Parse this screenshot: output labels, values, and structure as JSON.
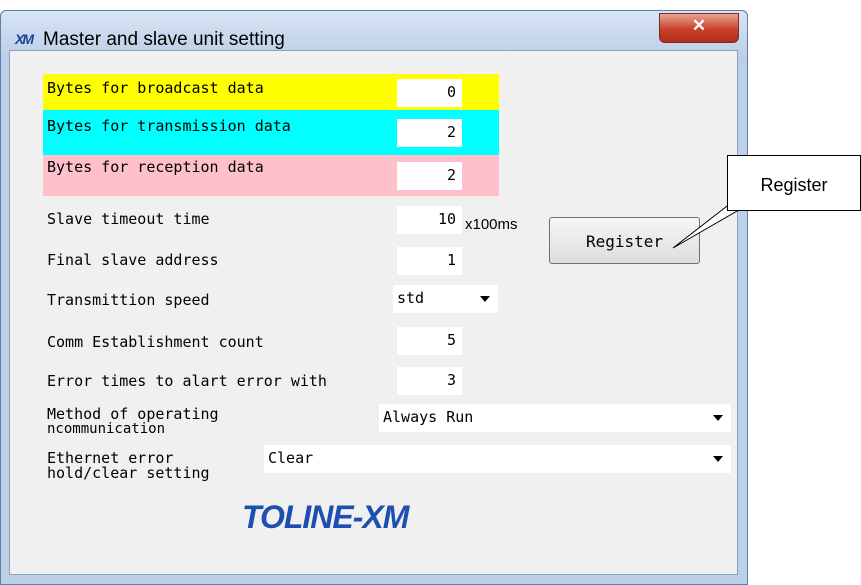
{
  "window": {
    "title": "Master and slave unit setting",
    "icon": "XM"
  },
  "colors": {
    "broadcast_band": "#ffff00",
    "transmission_band": "#00ffff",
    "reception_band": "#ffc0cb",
    "logo": "#1c4fb0"
  },
  "fields": {
    "broadcast": {
      "label": "Bytes for broadcast data",
      "value": "0"
    },
    "transmission": {
      "label": "Bytes for transmission data",
      "value": "2"
    },
    "reception": {
      "label": "Bytes for reception data",
      "value": "2"
    },
    "timeout": {
      "label": "Slave timeout time",
      "value": "10",
      "unit": "x100ms"
    },
    "final_address": {
      "label": "Final slave address",
      "value": "1"
    },
    "speed": {
      "label": "Transmittion speed",
      "value": "std"
    },
    "comm_count": {
      "label": "Comm Establishment count",
      "value": "5"
    },
    "error_times": {
      "label": "Error times to alart error with",
      "value": "3"
    },
    "method": {
      "label_line1": "Method of operating",
      "label_line2": "ncommunication",
      "value": "Always Run"
    },
    "ethernet": {
      "label_line1": "Ethernet error",
      "label_line2": "hold/clear setting",
      "value": "Clear"
    }
  },
  "register_button": "Register",
  "logo_text": "TOLINE-XM",
  "callout": "Register"
}
